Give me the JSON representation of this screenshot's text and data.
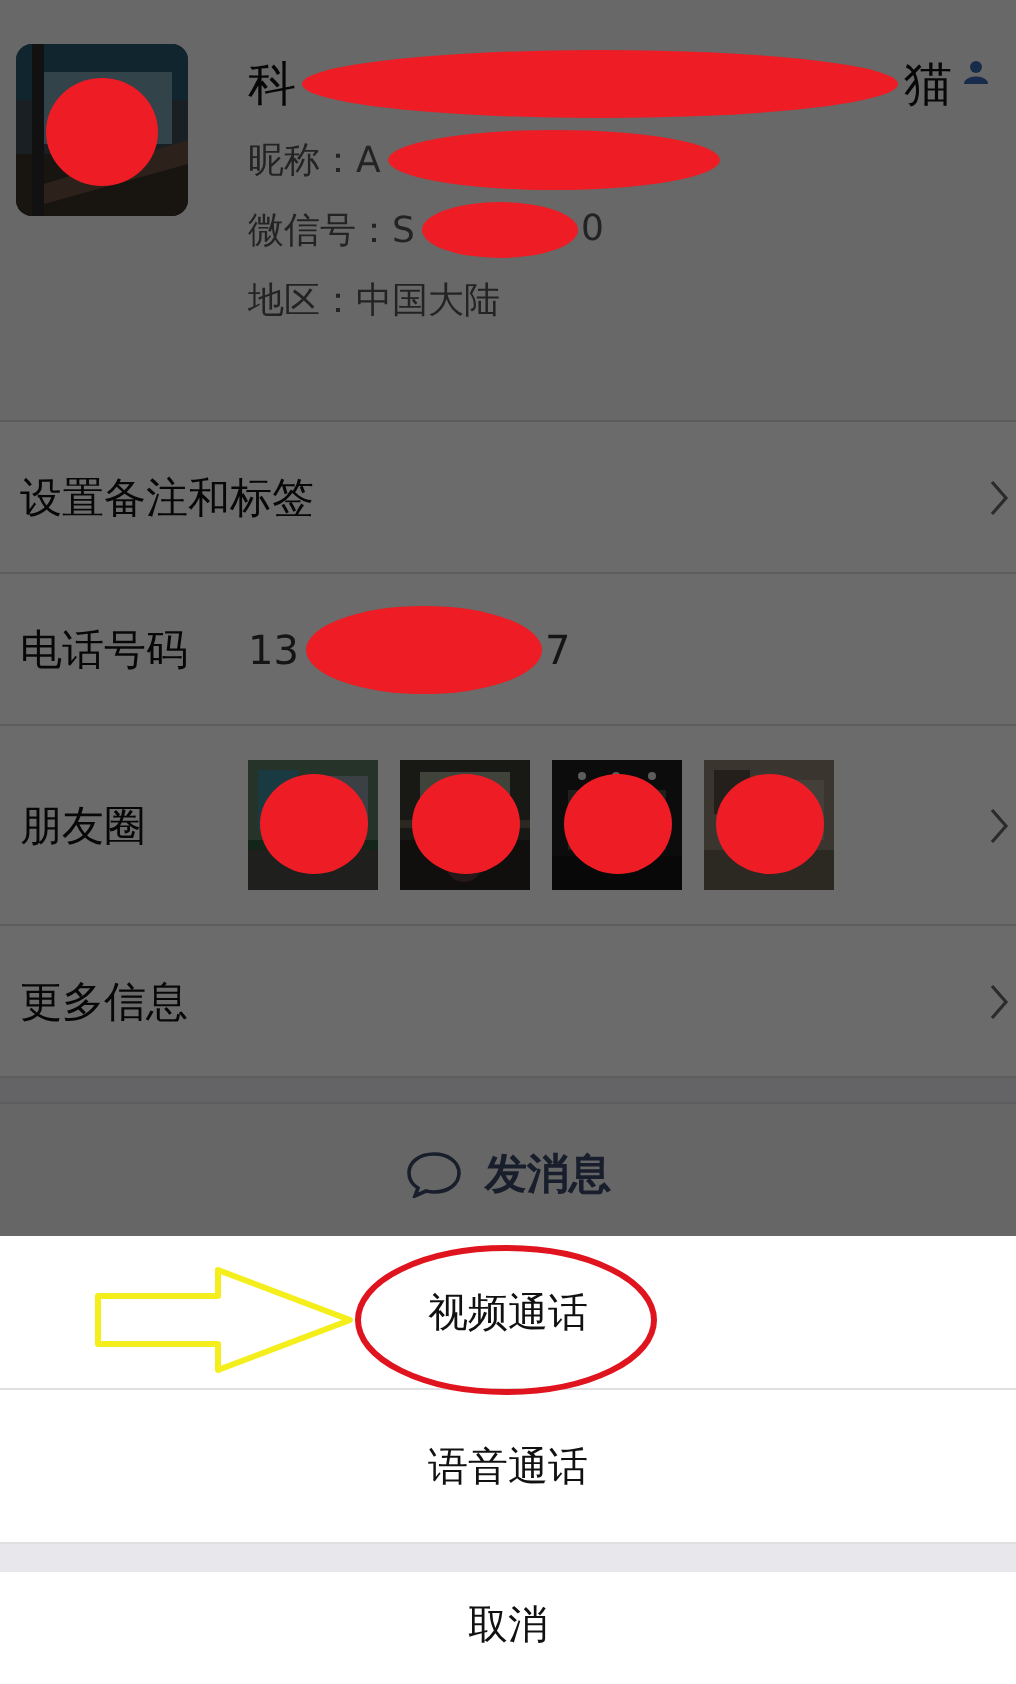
{
  "profile": {
    "name_start": "科",
    "name_end": "猫",
    "nickname": "昵称：A",
    "wechat_id": "微信号：S",
    "wechat_id_end": "0",
    "region": "地区：中国大陆"
  },
  "rows": [
    {
      "kind": "link",
      "label": "设置备注和标签"
    },
    {
      "kind": "phone",
      "label": "电话号码",
      "value_start": "13",
      "value_end": "7"
    },
    {
      "kind": "photos",
      "label": "朋友圈"
    },
    {
      "kind": "link",
      "label": "更多信息"
    }
  ],
  "send_message": {
    "label": "发消息"
  },
  "action_sheet": {
    "options": [
      "视频通话",
      "语音通话"
    ],
    "cancel": "取消"
  }
}
